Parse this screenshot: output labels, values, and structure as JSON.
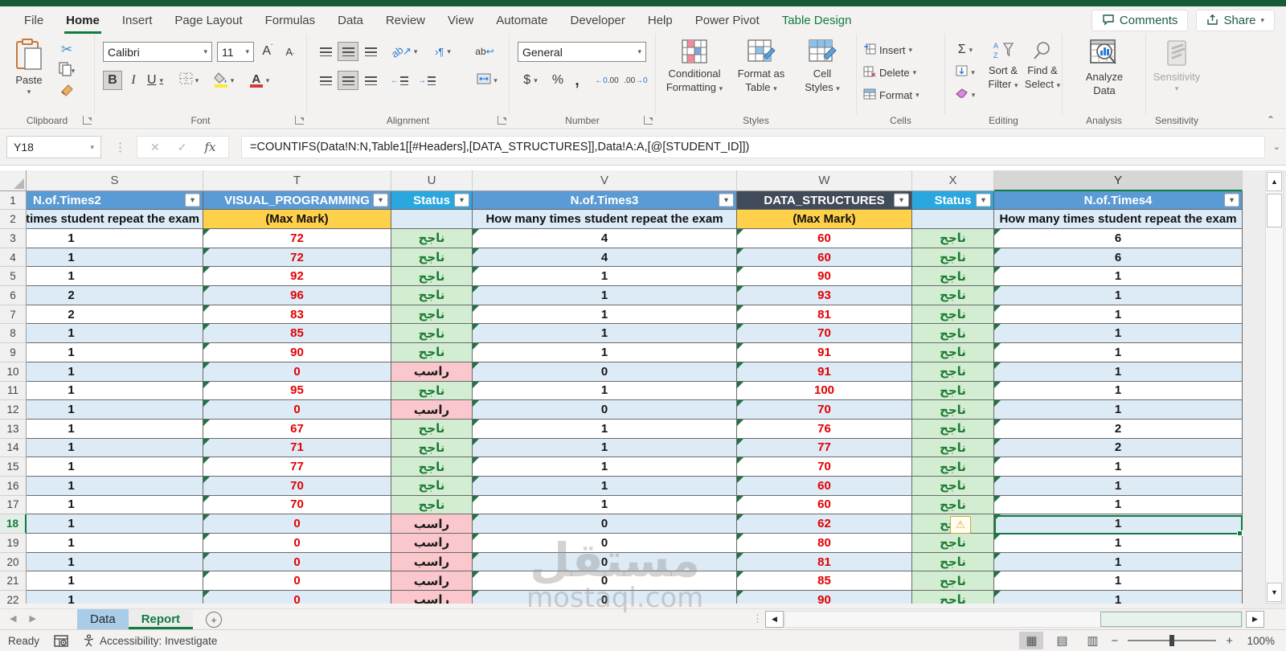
{
  "chrome": {
    "tabs": [
      "File",
      "Home",
      "Insert",
      "Page Layout",
      "Formulas",
      "Data",
      "Review",
      "View",
      "Automate",
      "Developer",
      "Help",
      "Power Pivot",
      "Table Design"
    ],
    "active_tab": "Home",
    "contextual_tab": "Table Design",
    "comments_label": "Comments",
    "share_label": "Share"
  },
  "ribbon": {
    "clipboard": {
      "label": "Clipboard",
      "paste": "Paste"
    },
    "font": {
      "label": "Font",
      "name": "Calibri",
      "size": "11",
      "bold": "B",
      "italic": "I",
      "underline": "U",
      "grow": "A",
      "shrink": "A"
    },
    "alignment": {
      "label": "Alignment",
      "wrap": "ab",
      "orient": "ab"
    },
    "number": {
      "label": "Number",
      "format": "General",
      "currency": "$",
      "percent": "%",
      "comma": ",",
      "inc_dec": ".00",
      "dec_dec": ".00"
    },
    "styles": {
      "label": "Styles",
      "b1a": "Conditional",
      "b1b": "Formatting",
      "b2a": "Format as",
      "b2b": "Table",
      "b3a": "Cell",
      "b3b": "Styles"
    },
    "cells": {
      "label": "Cells",
      "insert": "Insert",
      "delete": "Delete",
      "format": "Format"
    },
    "editing": {
      "label": "Editing",
      "autosum": "Σ",
      "b1a": "Sort &",
      "b1b": "Filter",
      "b2a": "Find &",
      "b2b": "Select"
    },
    "analysis": {
      "label": "Analysis",
      "b1a": "Analyze",
      "b1b": "Data"
    },
    "sensitivity": {
      "label": "Sensitivity",
      "button": "Sensitivity"
    }
  },
  "formula_bar": {
    "name_box": "Y18",
    "fx": "fx",
    "cancel": "✕",
    "enter": "✓",
    "formula": "=COUNTIFS(Data!N:N,Table1[[#Headers],[DATA_STRUCTURES]],Data!A:A,[@[STUDENT_ID]])"
  },
  "sheet": {
    "column_letters": [
      "S",
      "T",
      "U",
      "V",
      "W",
      "X",
      "Y"
    ],
    "selected_cell": "Y18",
    "selected_column": "Y",
    "selected_row": 18,
    "header_row": [
      {
        "col": "S",
        "label": "N.of.Times2",
        "variant": "blue",
        "align": "left"
      },
      {
        "col": "T",
        "label": "VISUAL_PROGRAMMING",
        "variant": "blue",
        "align": "center"
      },
      {
        "col": "U",
        "label": "Status",
        "variant": "cyan",
        "align": "center"
      },
      {
        "col": "V",
        "label": "N.of.Times3",
        "variant": "blue",
        "align": "center"
      },
      {
        "col": "W",
        "label": "DATA_STRUCTURES",
        "variant": "dark",
        "align": "center"
      },
      {
        "col": "X",
        "label": "Status",
        "variant": "cyan",
        "align": "center"
      },
      {
        "col": "Y",
        "label": "N.of.Times4",
        "variant": "blue",
        "align": "center"
      }
    ],
    "subheaders": {
      "s": "How many times student repeat the exam",
      "t": "(Max Mark)",
      "u": "",
      "v": "How many times student repeat the exam",
      "w": "(Max Mark)",
      "x": "",
      "y": "How many times student repeat the exam"
    },
    "status_labels": {
      "pass": "ناجح",
      "fail": "راسب"
    },
    "rows": [
      {
        "n": 3,
        "s": "1",
        "t": "72",
        "u": "pass",
        "v": "4",
        "w": "60",
        "x": "pass",
        "y": "6"
      },
      {
        "n": 4,
        "s": "1",
        "t": "72",
        "u": "pass",
        "v": "4",
        "w": "60",
        "x": "pass",
        "y": "6"
      },
      {
        "n": 5,
        "s": "1",
        "t": "92",
        "u": "pass",
        "v": "1",
        "w": "90",
        "x": "pass",
        "y": "1"
      },
      {
        "n": 6,
        "s": "2",
        "t": "96",
        "u": "pass",
        "v": "1",
        "w": "93",
        "x": "pass",
        "y": "1"
      },
      {
        "n": 7,
        "s": "2",
        "t": "83",
        "u": "pass",
        "v": "1",
        "w": "81",
        "x": "pass",
        "y": "1"
      },
      {
        "n": 8,
        "s": "1",
        "t": "85",
        "u": "pass",
        "v": "1",
        "w": "70",
        "x": "pass",
        "y": "1"
      },
      {
        "n": 9,
        "s": "1",
        "t": "90",
        "u": "pass",
        "v": "1",
        "w": "91",
        "x": "pass",
        "y": "1"
      },
      {
        "n": 10,
        "s": "1",
        "t": "0",
        "u": "fail",
        "v": "0",
        "w": "91",
        "x": "pass",
        "y": "1"
      },
      {
        "n": 11,
        "s": "1",
        "t": "95",
        "u": "pass",
        "v": "1",
        "w": "100",
        "x": "pass",
        "y": "1"
      },
      {
        "n": 12,
        "s": "1",
        "t": "0",
        "u": "fail",
        "v": "0",
        "w": "70",
        "x": "pass",
        "y": "1"
      },
      {
        "n": 13,
        "s": "1",
        "t": "67",
        "u": "pass",
        "v": "1",
        "w": "76",
        "x": "pass",
        "y": "2"
      },
      {
        "n": 14,
        "s": "1",
        "t": "71",
        "u": "pass",
        "v": "1",
        "w": "77",
        "x": "pass",
        "y": "2"
      },
      {
        "n": 15,
        "s": "1",
        "t": "77",
        "u": "pass",
        "v": "1",
        "w": "70",
        "x": "pass",
        "y": "1"
      },
      {
        "n": 16,
        "s": "1",
        "t": "70",
        "u": "pass",
        "v": "1",
        "w": "60",
        "x": "pass",
        "y": "1"
      },
      {
        "n": 17,
        "s": "1",
        "t": "70",
        "u": "pass",
        "v": "1",
        "w": "60",
        "x": "pass",
        "y": "1"
      },
      {
        "n": 18,
        "s": "1",
        "t": "0",
        "u": "fail",
        "v": "0",
        "w": "62",
        "x": "pass",
        "y": "1"
      },
      {
        "n": 19,
        "s": "1",
        "t": "0",
        "u": "fail",
        "v": "0",
        "w": "80",
        "x": "pass",
        "y": "1"
      },
      {
        "n": 20,
        "s": "1",
        "t": "0",
        "u": "fail",
        "v": "0",
        "w": "81",
        "x": "pass",
        "y": "1"
      },
      {
        "n": 21,
        "s": "1",
        "t": "0",
        "u": "fail",
        "v": "0",
        "w": "85",
        "x": "pass",
        "y": "1"
      },
      {
        "n": 22,
        "s": "1",
        "t": "0",
        "u": "fail",
        "v": "0",
        "w": "90",
        "x": "pass",
        "y": "1"
      }
    ],
    "warning_row": 18
  },
  "sheet_tabs": {
    "items": [
      {
        "label": "Data",
        "active": false
      },
      {
        "label": "Report",
        "active": true
      }
    ]
  },
  "status_bar": {
    "mode": "Ready",
    "accessibility": "Accessibility: Investigate",
    "zoom_level": "100%"
  },
  "watermark": {
    "arabic": "مستقل",
    "latin": "mostaql.com"
  },
  "colors": {
    "excel_green": "#107c41",
    "header_blue": "#5b9bd5",
    "header_cyan": "#2ba7e0",
    "header_dark": "#414b5a",
    "band_blue": "#ddebf7",
    "gold": "#ffd04a",
    "pass_bg": "#d2edd2",
    "fail_bg": "#f9c7cc",
    "mark_red": "#e30000"
  }
}
